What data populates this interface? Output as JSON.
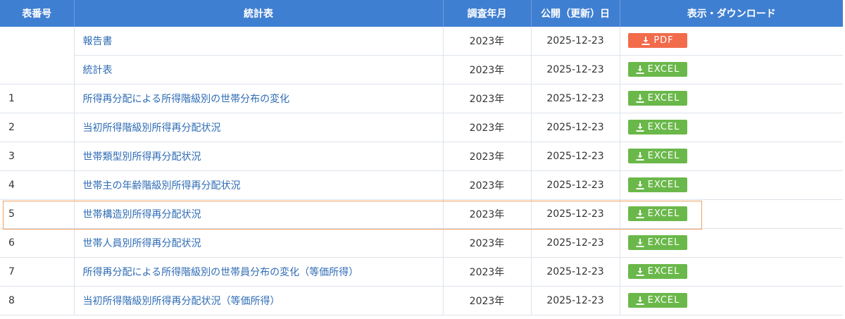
{
  "header": {
    "col_num": "表番号",
    "col_title": "統計表",
    "col_year": "調査年月",
    "col_date": "公開（更新）日",
    "col_download": "表示・ダウンロード"
  },
  "rows": [
    {
      "num": "",
      "title": "報告書",
      "year": "2023年",
      "date": "2025-12-23",
      "format": "PDF",
      "type": "pdf"
    },
    {
      "num": "",
      "title": "統計表",
      "year": "2023年",
      "date": "2025-12-23",
      "format": "EXCEL",
      "type": "excel"
    },
    {
      "num": "1",
      "title": "所得再分配による所得階級別の世帯分布の変化",
      "year": "2023年",
      "date": "2025-12-23",
      "format": "EXCEL",
      "type": "excel"
    },
    {
      "num": "2",
      "title": "当初所得階級別所得再分配状況",
      "year": "2023年",
      "date": "2025-12-23",
      "format": "EXCEL",
      "type": "excel"
    },
    {
      "num": "3",
      "title": "世帯類型別所得再分配状況",
      "year": "2023年",
      "date": "2025-12-23",
      "format": "EXCEL",
      "type": "excel"
    },
    {
      "num": "4",
      "title": "世帯主の年齢階級別所得再分配状況",
      "year": "2023年",
      "date": "2025-12-23",
      "format": "EXCEL",
      "type": "excel"
    },
    {
      "num": "5",
      "title": "世帯構造別所得再分配状況",
      "year": "2023年",
      "date": "2025-12-23",
      "format": "EXCEL",
      "type": "excel"
    },
    {
      "num": "6",
      "title": "世帯人員別所得再分配状況",
      "year": "2023年",
      "date": "2025-12-23",
      "format": "EXCEL",
      "type": "excel"
    },
    {
      "num": "7",
      "title": "所得再分配による所得階級別の世帯員分布の変化（等価所得）",
      "year": "2023年",
      "date": "2025-12-23",
      "format": "EXCEL",
      "type": "excel"
    },
    {
      "num": "8",
      "title": "当初所得階級別所得再分配状況（等価所得）",
      "year": "2023年",
      "date": "2025-12-23",
      "format": "EXCEL",
      "type": "excel"
    }
  ],
  "icons": {
    "download": "download-icon"
  },
  "colors": {
    "header_bg": "#3f7fd1",
    "pdf": "#f26b4b",
    "excel": "#6ab84a",
    "link": "#2f6cb5",
    "focus": "#f0a060"
  }
}
